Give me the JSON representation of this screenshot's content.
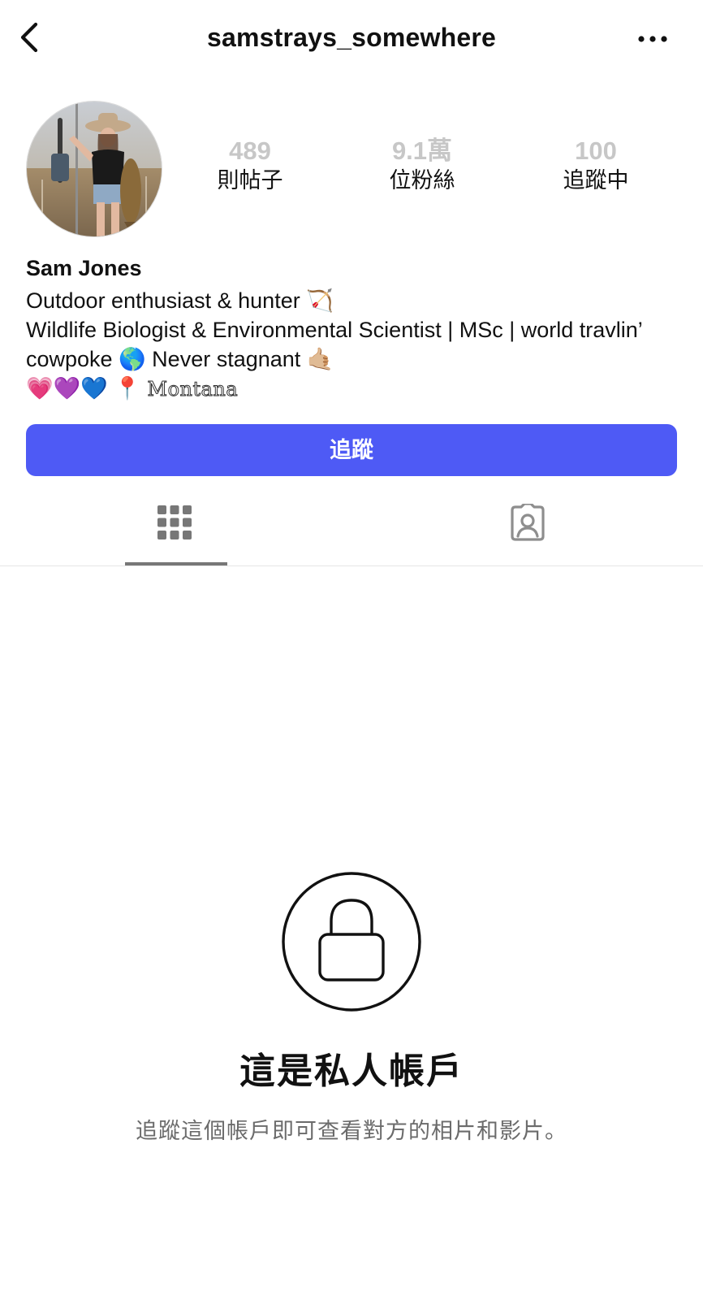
{
  "header": {
    "username": "samstrays_somewhere"
  },
  "profile": {
    "stats": {
      "posts_value": "489",
      "posts_label": "則帖子",
      "followers_value": "9.1萬",
      "followers_label": "位粉絲",
      "following_value": "100",
      "following_label": "追蹤中"
    },
    "bio": {
      "name": "Sam Jones",
      "line1": "Outdoor enthusiast & hunter 🏹",
      "line2": "Wildlife Biologist & Environmental Scientist | MSc | world travlin’ cowpoke 🌎 Never stagnant 🤙🏼",
      "line3_emoji": "💗💜💙 📍",
      "line3_location": "Montana"
    }
  },
  "follow_button": {
    "label": "追蹤"
  },
  "private_notice": {
    "title": "這是私人帳戶",
    "description": "追蹤這個帳戶即可查看對方的相片和影片。"
  },
  "colors": {
    "accent": "#4e5af5",
    "stat_value": "#c7c7c7",
    "muted_text": "#6b6b6b",
    "tab_indicator": "#777777"
  },
  "icons": {
    "back": "chevron-left-icon",
    "more": "more-horizontal-icon",
    "grid_tab": "grid-icon",
    "tagged_tab": "tagged-person-icon",
    "lock": "lock-icon"
  }
}
